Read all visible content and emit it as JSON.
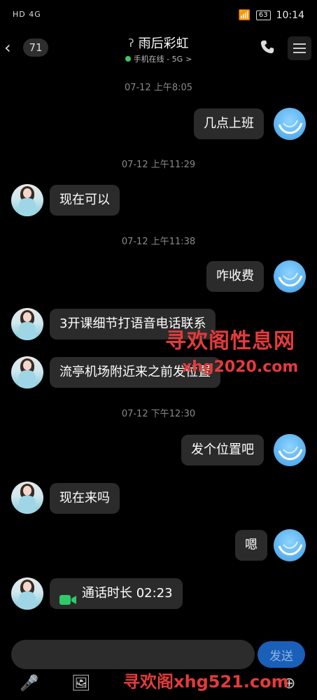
{
  "status": {
    "left": "HD 4G",
    "battery": "63",
    "time": "10:14"
  },
  "header": {
    "count": "71",
    "title": "雨后彩虹",
    "subtitle": "手机在线 - 5G",
    "subtitle_arrow": ">"
  },
  "messages": {
    "t1": "07-12 上午8:05",
    "m1": "几点上班",
    "t2": "07-12 上午11:29",
    "m2": "现在可以",
    "t3": "07-12 上午11:38",
    "m3": "咋收费",
    "m4": "3开课细节打语音电话联系",
    "m5": "流亭机场附近来之前发位置",
    "t4": "07-12 下午12:30",
    "m6": "发个位置吧",
    "m7": "现在来吗",
    "m8": "嗯",
    "m9": "通话时长 02:23"
  },
  "watermarks": {
    "w1": "寻欢阁性息网",
    "w2": "xhg2020.com",
    "w3": "寻欢阁xhg521.com"
  },
  "input": {
    "send": "发送"
  },
  "colors": {
    "accent": "#1a5fb8",
    "online": "#39c86a",
    "watermark": "#e43b3b"
  }
}
